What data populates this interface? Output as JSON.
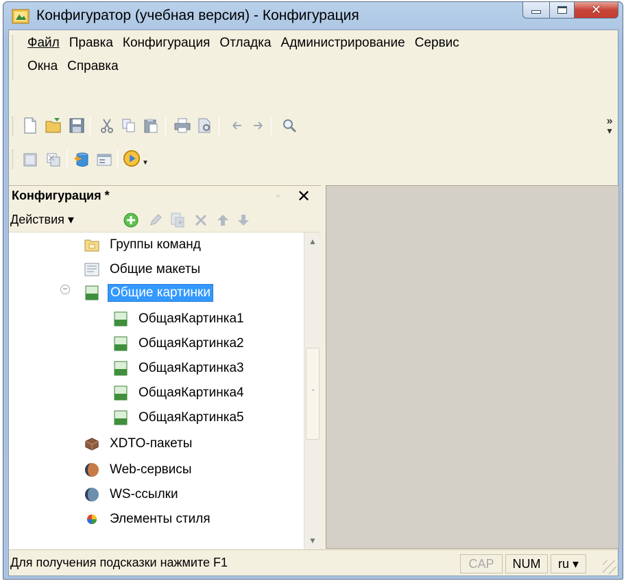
{
  "window": {
    "title": "Конфигуратор (учебная версия) - Конфигурация"
  },
  "menu": {
    "row1": [
      {
        "label": "Файл"
      },
      {
        "label": "Правка"
      },
      {
        "label": "Конфигурация"
      },
      {
        "label": "Отладка"
      },
      {
        "label": "Администрирование"
      },
      {
        "label": "Сервис"
      }
    ],
    "row2": [
      {
        "label": "Окна"
      },
      {
        "label": "Справка"
      }
    ]
  },
  "toolbar": {
    "overflow_label": "»"
  },
  "panel": {
    "title": "Конфигурация *",
    "close_label": "✕",
    "actions_label": "Действия ▾"
  },
  "tree": {
    "items": [
      {
        "label": "Группы команд",
        "icon": "folder-icon",
        "level": 1
      },
      {
        "label": "Общие макеты",
        "icon": "template-icon",
        "level": 1
      },
      {
        "label": "Общие картинки",
        "icon": "picture-icon",
        "level": 1,
        "expanded": true,
        "selected": true
      },
      {
        "label": "ОбщаяКартинка1",
        "icon": "picture-icon",
        "level": 2
      },
      {
        "label": "ОбщаяКартинка2",
        "icon": "picture-icon",
        "level": 2
      },
      {
        "label": "ОбщаяКартинка3",
        "icon": "picture-icon",
        "level": 2
      },
      {
        "label": "ОбщаяКартинка4",
        "icon": "picture-icon",
        "level": 2
      },
      {
        "label": "ОбщаяКартинка5",
        "icon": "picture-icon",
        "level": 2
      },
      {
        "label": "XDTO-пакеты",
        "icon": "package-icon",
        "level": 1
      },
      {
        "label": "Web-сервисы",
        "icon": "web-service-icon",
        "level": 1
      },
      {
        "label": "WS-ссылки",
        "icon": "ws-link-icon",
        "level": 1
      },
      {
        "label": "Элементы стиля",
        "icon": "style-icon",
        "level": 1
      }
    ]
  },
  "status": {
    "hint": "Для получения подсказки нажмите F1",
    "cap": "CAP",
    "num": "NUM",
    "lang": "ru ▾"
  },
  "colors": {
    "selection": "#3399ff",
    "client_bg": "#f4f0e0",
    "workarea_bg": "#d4d0c8",
    "title_gradient": "#b9d1ea"
  }
}
